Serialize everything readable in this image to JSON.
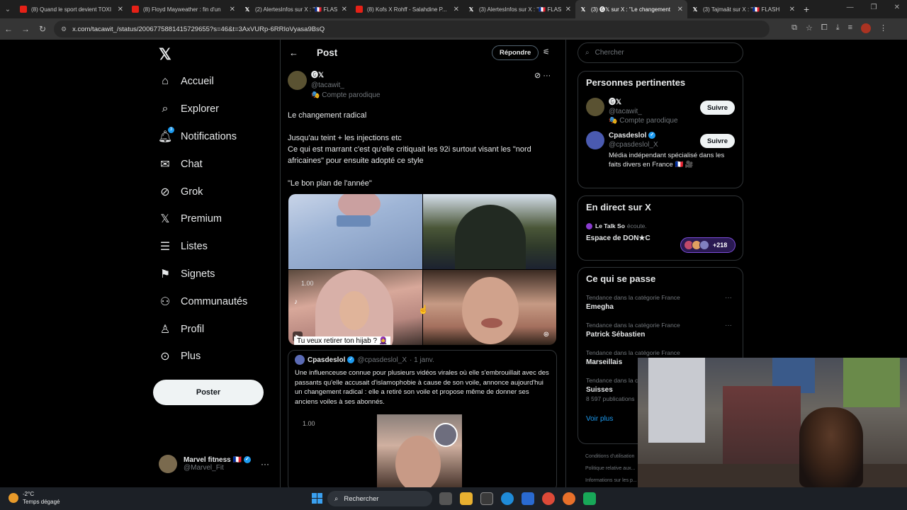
{
  "browser": {
    "tabs": [
      {
        "label": "(8) Quand le sport devient TOXI",
        "type": "yt"
      },
      {
        "label": "(8) Floyd Mayweather : fin d'un",
        "type": "yt"
      },
      {
        "label": "(2) AlertesInfos sur X : \"🇫🇷 FLAS",
        "type": "x"
      },
      {
        "label": "(8) Kofs X Rohff - Salahdine P...",
        "type": "yt"
      },
      {
        "label": "(3) AlertesInfos sur X : \"🇫🇷 FLAS",
        "type": "x"
      },
      {
        "label": "(3) 🅖𝕏 sur X : \"Le changement",
        "type": "x",
        "active": true
      },
      {
        "label": "(3) Tajmaât sur X : \"🇫🇷 FLASH",
        "type": "x"
      }
    ],
    "url": "x.com/tacawit_/status/2006775881415729655?s=46&t=3AxVURp-6RRIoVyasa9BsQ"
  },
  "sidebar": {
    "items": [
      {
        "label": "Accueil",
        "icon": "home-icon"
      },
      {
        "label": "Explorer",
        "icon": "search-icon"
      },
      {
        "label": "Notifications",
        "icon": "bell-icon",
        "badge": "3"
      },
      {
        "label": "Chat",
        "icon": "mail-icon"
      },
      {
        "label": "Grok",
        "icon": "grok-icon"
      },
      {
        "label": "Premium",
        "icon": "x-icon"
      },
      {
        "label": "Listes",
        "icon": "list-icon"
      },
      {
        "label": "Signets",
        "icon": "bookmark-icon"
      },
      {
        "label": "Communautés",
        "icon": "communities-icon"
      },
      {
        "label": "Profil",
        "icon": "person-icon"
      },
      {
        "label": "Plus",
        "icon": "more-circle-icon"
      }
    ],
    "post_button": "Poster",
    "account": {
      "name": "Marvel fitness 🇫🇷",
      "handle": "@Marvel_Fit"
    }
  },
  "main": {
    "title": "Post",
    "reply_button": "Répondre",
    "author": {
      "name": "🅖𝕏",
      "handle": "@tacawit_",
      "label": "🎭 Compte parodique"
    },
    "text": {
      "p1": "Le changement radical",
      "p2a": "Jusqu'au teint + les injections etc",
      "p2b": "Ce qui est marrant c'est qu'elle critiquait les 92i surtout visant  les \"nord africaines\"  pour ensuite adopté ce style",
      "p3": "\"Le bon plan de l'année\""
    },
    "media": {
      "caption": "Tu veux retirer ton hijab ? 🧕",
      "time_label": "1.00",
      "tiktok": "TikTok"
    },
    "quote": {
      "name": "Cpasdeslol",
      "handle": "@cpasdeslol_X",
      "date": "· 1 janv.",
      "text": "Une influenceuse connue pour plusieurs vidéos virales où elle s'embrouillait avec des passants qu'elle accusait d'islamophobie à cause de son voile, annonce aujourd'hui un changement radical : elle a retiré son voile et propose même de donner ses anciens voiles à ses abonnés.",
      "time_label": "1.00"
    }
  },
  "right": {
    "search_placeholder": "Chercher",
    "relevant_title": "Personnes pertinentes",
    "people": [
      {
        "name": "🅖𝕏",
        "handle": "@tacawit_",
        "sub": "🎭 Compte parodique",
        "button": "Suivre"
      },
      {
        "name": "Cpasdeslol",
        "handle": "@cpasdeslol_X",
        "bio": "Média indépendant spécialisé dans les faits divers en France 🇫🇷 🎥",
        "button": "Suivre"
      }
    ],
    "live": {
      "title": "En direct sur X",
      "host": "Le Talk So",
      "status": "écoute.",
      "space": "Espace de DON★C",
      "listeners": "+218"
    },
    "trends": {
      "title": "Ce qui se passe",
      "items": [
        {
          "category": "Tendance dans la catégorie France",
          "name": "Emegha"
        },
        {
          "category": "Tendance dans la catégorie France",
          "name": "Patrick Sébastien"
        },
        {
          "category": "Tendance dans la catégorie France",
          "name": "Marseillais"
        },
        {
          "category": "Tendance dans la catégorie France",
          "name": "Suisses",
          "count": "8 597 publications"
        }
      ],
      "show_more": "Voir plus"
    },
    "footer": [
      "Conditions d'utilisation",
      "Politique relative aux...",
      "Informations sur les p..."
    ]
  },
  "taskbar": {
    "temp": "-2°C",
    "weather": "Temps dégagé",
    "search": "Rechercher"
  }
}
